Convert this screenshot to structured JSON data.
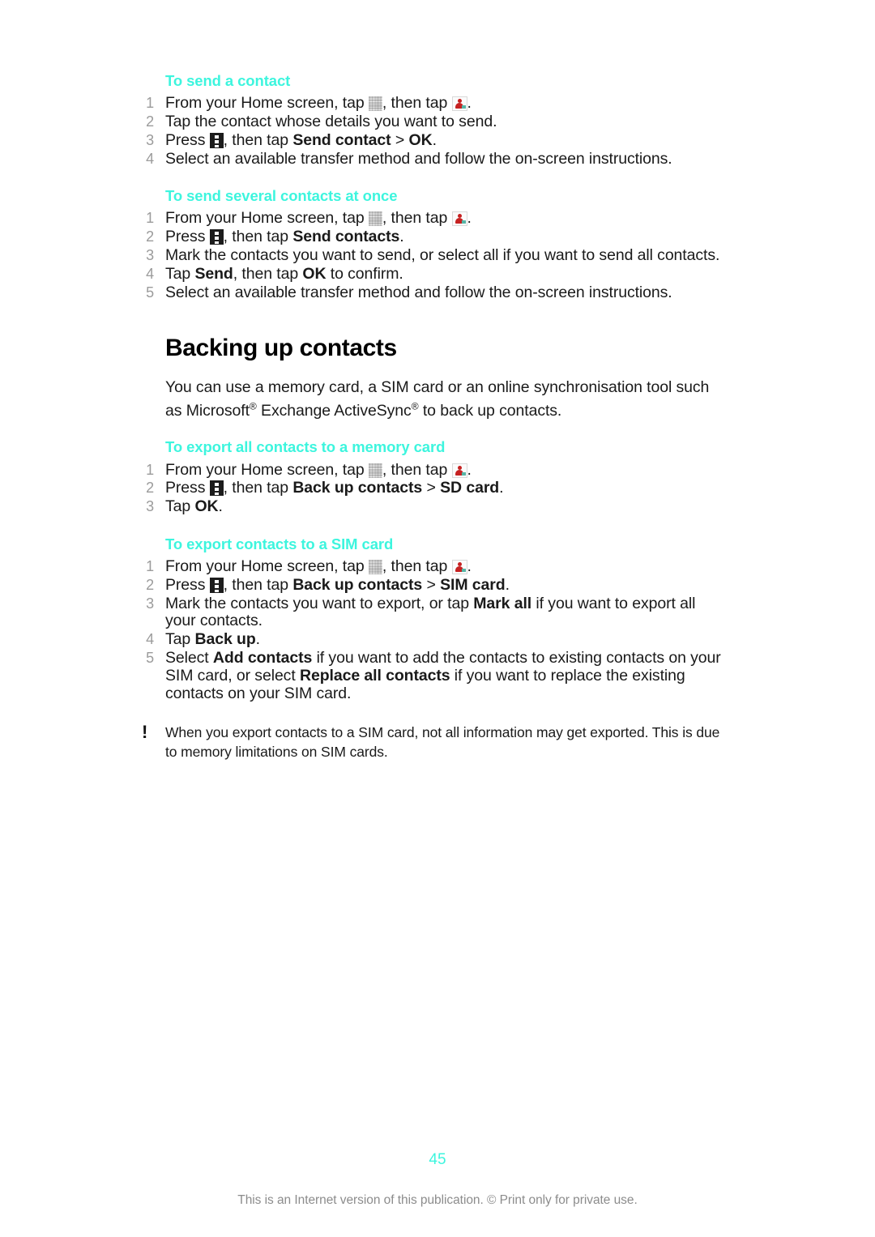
{
  "document": {
    "page_number": "45",
    "footer_note": "This is an Internet version of this publication. © Print only for private use.",
    "accent_color": "#3DF5DE",
    "step_number_color": "#9b9b9b",
    "text_color": "#1a1a1a"
  },
  "icons": {
    "grid": "app-drawer-grid-icon",
    "contact": "contacts-app-icon",
    "menu": "menu-key-icon",
    "caution": "caution-exclamation-icon"
  },
  "sections": {
    "send_contact": {
      "heading": "To send a contact",
      "steps": {
        "s1_a": "From your Home screen, tap ",
        "s1_b": ", then tap ",
        "s1_c": ".",
        "s2": "Tap the contact whose details you want to send.",
        "s3_a": "Press ",
        "s3_b": ", then tap ",
        "s3_bold": "Send contact",
        "s3_c": " > ",
        "s3_bold2": "OK",
        "s3_d": ".",
        "s4": "Select an available transfer method and follow the on-screen instructions."
      }
    },
    "send_several": {
      "heading": "To send several contacts at once",
      "steps": {
        "s1_a": "From your Home screen, tap ",
        "s1_b": ", then tap ",
        "s1_c": ".",
        "s2_a": "Press ",
        "s2_b": ", then tap ",
        "s2_bold": "Send contacts",
        "s2_c": ".",
        "s3": "Mark the contacts you want to send, or select all if you want to send all contacts.",
        "s4_a": "Tap ",
        "s4_bold": "Send",
        "s4_b": ", then tap ",
        "s4_bold2": "OK",
        "s4_c": " to confirm.",
        "s5": "Select an available transfer method and follow the on-screen instructions."
      }
    },
    "backing_up": {
      "heading": "Backing up contacts",
      "paragraph_a": "You can use a memory card, a SIM card or an online synchronisation tool such as Microsoft",
      "paragraph_sup1": "®",
      "paragraph_b": " Exchange ActiveSync",
      "paragraph_sup2": "®",
      "paragraph_c": " to back up contacts."
    },
    "export_memory_card": {
      "heading": "To export all contacts to a memory card",
      "steps": {
        "s1_a": "From your Home screen, tap ",
        "s1_b": ", then tap ",
        "s1_c": ".",
        "s2_a": "Press ",
        "s2_b": ", then tap ",
        "s2_bold": "Back up contacts",
        "s2_c": " > ",
        "s2_bold2": "SD card",
        "s2_d": ".",
        "s3_a": "Tap ",
        "s3_bold": "OK",
        "s3_b": "."
      }
    },
    "export_sim_card": {
      "heading": "To export contacts to a SIM card",
      "steps": {
        "s1_a": "From your Home screen, tap ",
        "s1_b": ", then tap ",
        "s1_c": ".",
        "s2_a": "Press ",
        "s2_b": ", then tap ",
        "s2_bold": "Back up contacts",
        "s2_c": " > ",
        "s2_bold2": "SIM card",
        "s2_d": ".",
        "s3_a": "Mark the contacts you want to export, or tap ",
        "s3_bold": "Mark all",
        "s3_b": " if you want to export all your contacts.",
        "s4_a": "Tap ",
        "s4_bold": "Back up",
        "s4_b": ".",
        "s5_a": "Select ",
        "s5_bold": "Add contacts",
        "s5_b": " if you want to add the contacts to existing contacts on your SIM card, or select ",
        "s5_bold2": "Replace all contacts",
        "s5_c": " if you want to replace the existing contacts on your SIM card."
      }
    },
    "note": {
      "marker": "!",
      "text": "When you export contacts to a SIM card, not all information may get exported. This is due to memory limitations on SIM cards."
    }
  }
}
